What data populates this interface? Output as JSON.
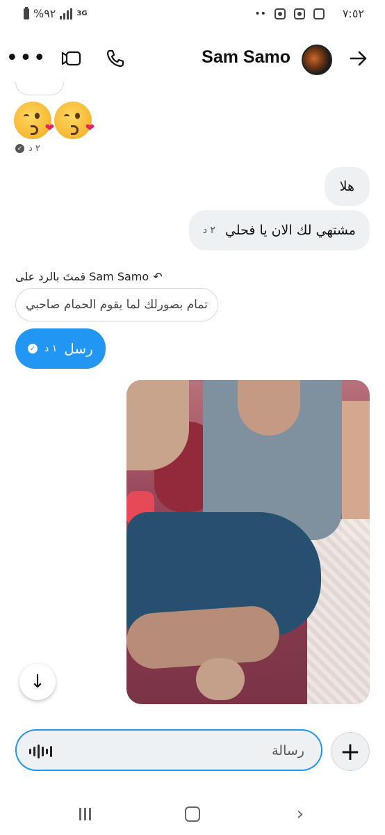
{
  "status_bar": {
    "battery": "%٩٢",
    "network": "3G",
    "time": "٧:٥٢",
    "dots": "••"
  },
  "header": {
    "contact_name": "Sam Samo",
    "more_icon": "more-dots-icon",
    "video_icon": "video-call-icon",
    "phone_icon": "phone-icon",
    "back_icon": "arrow-right-icon"
  },
  "messages": {
    "emoji_time": "٢ د",
    "bubble1": "هلا",
    "bubble2": "مشتهي لك الان يا فحلي",
    "bubble2_time": "٢ د",
    "reply_note": "قمتَ بالرد على Sam Samo",
    "quoted_text": "تمام بصورلك لما يقوم الحمام صاحبي",
    "sent_text": "رسل",
    "sent_time": "١ د"
  },
  "composer": {
    "placeholder": "رسالة"
  },
  "colors": {
    "accent": "#2196f3",
    "bubble_gray": "#eef1f3"
  }
}
